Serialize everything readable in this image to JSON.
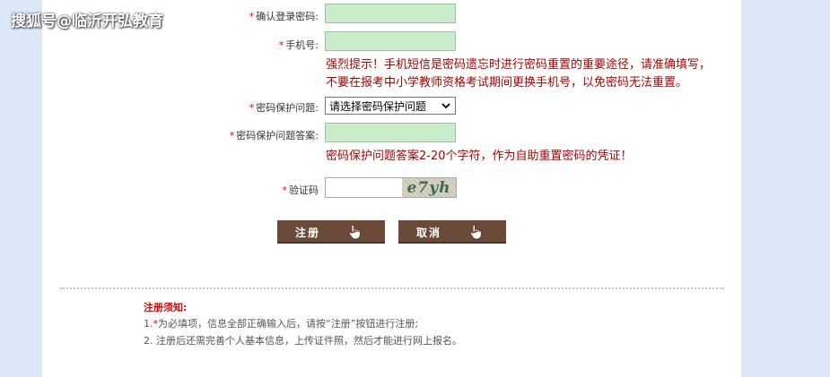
{
  "watermark": "搜狐号@临沂开弘教育",
  "form": {
    "confirm_password_label": "确认登录密码:",
    "phone_label": "手机号:",
    "phone_hint_line1": "强烈提示！手机短信是密码遗忘时进行密码重置的重要途径，请准确填写，",
    "phone_hint_line2": "不要在报考中小学教师资格考试期间更换手机号，以免密码无法重置。",
    "security_question_label": "密码保护问题:",
    "security_question_selected": "请选择密码保护问题",
    "security_answer_label": "密码保护问题答案:",
    "security_answer_hint": "密码保护问题答案2-20个字符，作为自助重置密码的凭证！",
    "captcha_label": "验证码",
    "captcha_text": "e7yh",
    "required_mark": "*"
  },
  "buttons": {
    "register": "注册",
    "cancel": "取消"
  },
  "notice": {
    "title": "注册须知:",
    "line1_prefix": "1.",
    "line1_rest": "为必填项，信息全部正确输入后，请按“注册”按钮进行注册;",
    "line2": "2. 注册后还需完善个人基本信息，上传证件照，然后才能进行网上报名。"
  },
  "colors": {
    "input_bg": "#c9eccb",
    "button_bg": "#6b4a3a",
    "hint_red": "#b10000",
    "page_bg": "#dce8f7"
  }
}
